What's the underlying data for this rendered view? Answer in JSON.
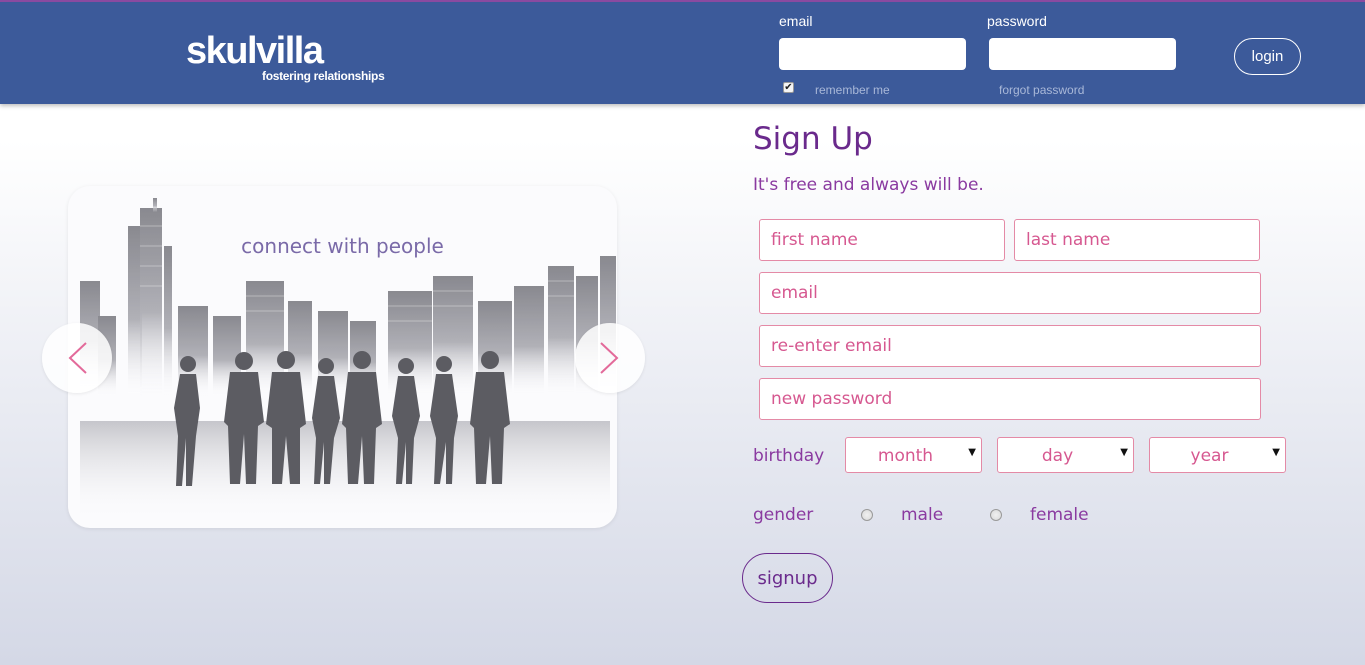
{
  "colors": {
    "brand": "#3c5a9a",
    "accent": "#6a2a8c",
    "field_border": "#e48aa6"
  },
  "header": {
    "logo_name": "skulvilla",
    "logo_tagline": "fostering relationships",
    "email_label": "email",
    "password_label": "password",
    "remember_checked": true,
    "remember_label": "remember me",
    "forgot_label": "forgot password",
    "login_label": "login"
  },
  "carousel": {
    "caption": "connect with people",
    "prev_icon": "chevron-left-icon",
    "next_icon": "chevron-right-icon"
  },
  "signup": {
    "title": "Sign Up",
    "subtitle": "It's free and always will be.",
    "first_name_placeholder": "first name",
    "last_name_placeholder": "last name",
    "email_placeholder": "email",
    "reenter_email_placeholder": "re-enter email",
    "password_placeholder": "new password",
    "birthday_label": "birthday",
    "month": "month",
    "day": "day",
    "year": "year",
    "gender_label": "gender",
    "male_label": "male",
    "female_label": "female",
    "submit_label": "signup"
  }
}
